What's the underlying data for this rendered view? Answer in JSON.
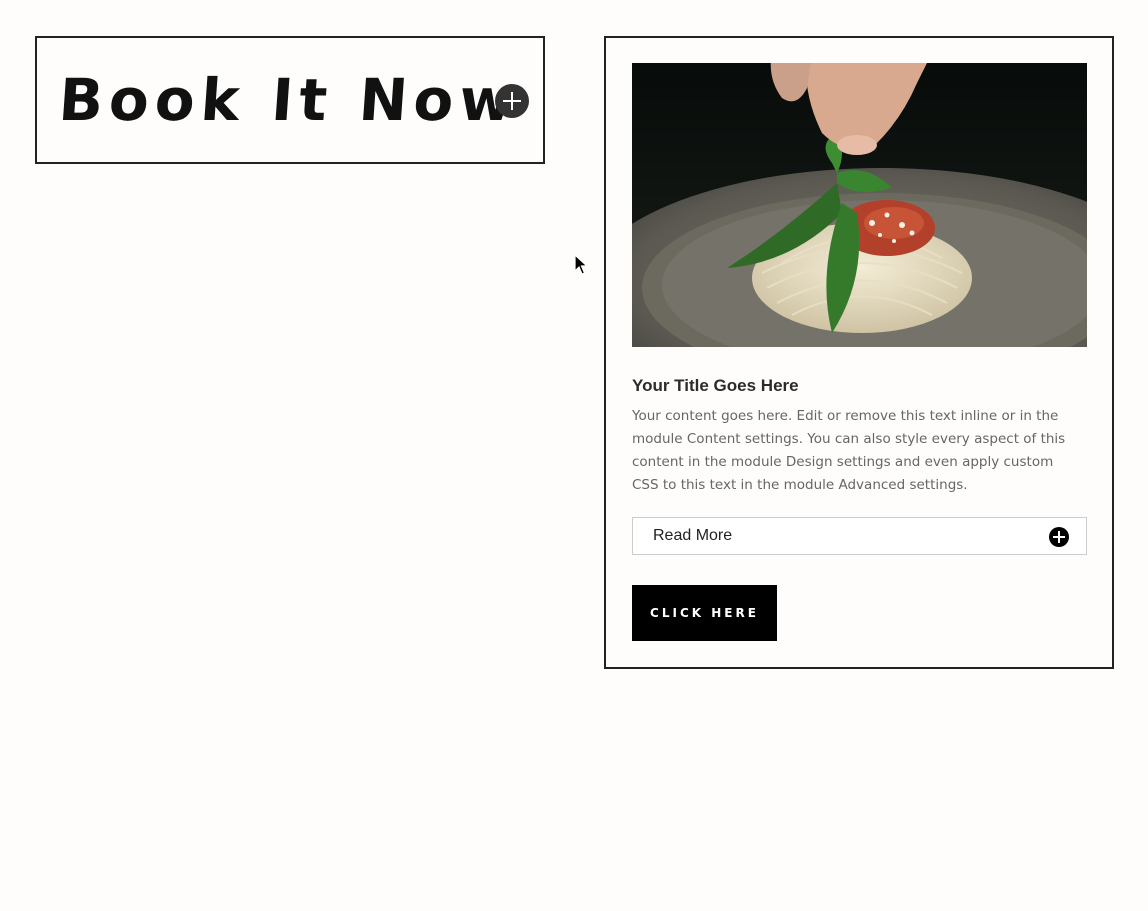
{
  "book_module": {
    "title": "Book It Now",
    "toggle_icon": "plus-circle-icon"
  },
  "card": {
    "image_alt": "Spaghetti with tomato sauce, parmesan and basil leaf",
    "title": "Your Title Goes Here",
    "body": "Your content goes here. Edit or remove this text inline or in the module Content settings. You can also style every aspect of this content in the module Design settings and even apply custom CSS to this text in the module Advanced settings.",
    "read_more": {
      "label": "Read More",
      "icon": "plus-circle-icon"
    },
    "button_label": "CLICK HERE"
  },
  "colors": {
    "background": "#fefdfb",
    "border": "#222222",
    "button_bg": "#000000",
    "button_text": "#ffffff",
    "body_text": "#666666"
  }
}
